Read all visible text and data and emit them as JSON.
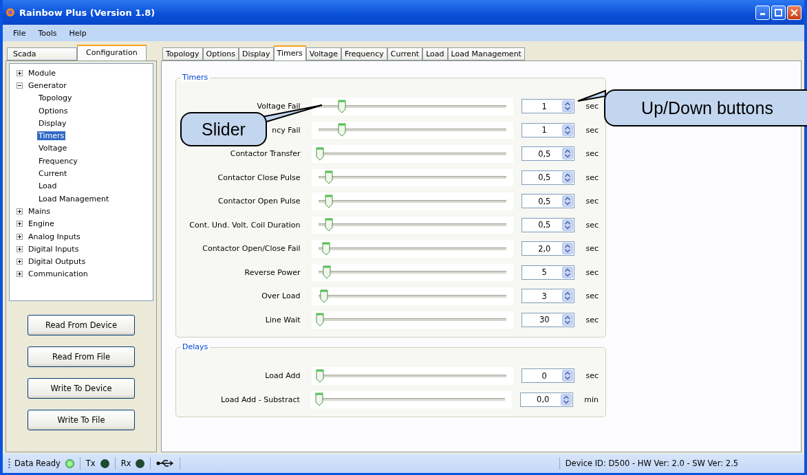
{
  "window": {
    "title": "Rainbow Plus (Version 1.8)"
  },
  "menu": [
    "File",
    "Tools",
    "Help"
  ],
  "left_tabs": [
    {
      "label": "Scada",
      "selected": false
    },
    {
      "label": "Configuration",
      "selected": true
    }
  ],
  "tree": [
    {
      "label": "Module",
      "expanded": false,
      "selected": false
    },
    {
      "label": "Generator",
      "expanded": true,
      "selected": false,
      "children": [
        {
          "label": "Topology",
          "selected": false
        },
        {
          "label": "Options",
          "selected": false
        },
        {
          "label": "Display",
          "selected": false
        },
        {
          "label": "Timers",
          "selected": true
        },
        {
          "label": "Voltage",
          "selected": false
        },
        {
          "label": "Frequency",
          "selected": false
        },
        {
          "label": "Current",
          "selected": false
        },
        {
          "label": "Load",
          "selected": false
        },
        {
          "label": "Load Management",
          "selected": false
        }
      ]
    },
    {
      "label": "Mains",
      "expanded": false,
      "selected": false
    },
    {
      "label": "Engine",
      "expanded": false,
      "selected": false
    },
    {
      "label": "Analog Inputs",
      "expanded": false,
      "selected": false
    },
    {
      "label": "Digital Inputs",
      "expanded": false,
      "selected": false
    },
    {
      "label": "Digital Outputs",
      "expanded": false,
      "selected": false
    },
    {
      "label": "Communication",
      "expanded": false,
      "selected": false
    }
  ],
  "buttons": [
    "Read From Device",
    "Read From File",
    "Write To Device",
    "Write To File"
  ],
  "tabs": [
    {
      "label": "Topology",
      "selected": false
    },
    {
      "label": "Options",
      "selected": false
    },
    {
      "label": "Display",
      "selected": false
    },
    {
      "label": "Timers",
      "selected": true
    },
    {
      "label": "Voltage",
      "selected": false
    },
    {
      "label": "Frequency",
      "selected": false
    },
    {
      "label": "Current",
      "selected": false
    },
    {
      "label": "Load",
      "selected": false
    },
    {
      "label": "Load Management",
      "selected": false
    }
  ],
  "groups": [
    {
      "title": "Timers",
      "rows": [
        {
          "label": "Voltage Fail",
          "level": 0.12,
          "value": "1",
          "unit": "sec"
        },
        {
          "label": "ncy Fail",
          "level": 0.12,
          "value": "1",
          "unit": "sec"
        },
        {
          "label": "Contactor Transfer",
          "level": 0,
          "value": "0,5",
          "unit": "sec"
        },
        {
          "label": "Contactor Close Pulse",
          "level": 0.05,
          "value": "0,5",
          "unit": "sec"
        },
        {
          "label": "Contactor Open Pulse",
          "level": 0.05,
          "value": "0,5",
          "unit": "sec"
        },
        {
          "label": "Cont. Und. Volt. Coil Duration",
          "level": 0.05,
          "value": "0,5",
          "unit": "sec"
        },
        {
          "label": "Contactor Open/Close Fail",
          "level": 0.035,
          "value": "2,0",
          "unit": "sec"
        },
        {
          "label": "Reverse Power",
          "level": 0.04,
          "value": "5",
          "unit": "sec"
        },
        {
          "label": "Over Load",
          "level": 0.025,
          "value": "3",
          "unit": "sec"
        },
        {
          "label": "Line Wait",
          "level": 0,
          "value": "30",
          "unit": "sec"
        }
      ]
    },
    {
      "title": "Delays",
      "rows": [
        {
          "label": "Load Add",
          "level": 0,
          "value": "0",
          "unit": "sec"
        },
        {
          "label": "Load Add - Substract",
          "level": 0,
          "value": "0,0",
          "unit": "min"
        }
      ]
    }
  ],
  "callouts": [
    {
      "text": "Slider"
    },
    {
      "text": "Up/Down buttons"
    }
  ],
  "status_bar": {
    "indicators": [
      {
        "label": "Data Ready",
        "on": true
      },
      {
        "label": "Tx",
        "on": false
      },
      {
        "label": "Rx",
        "on": false
      }
    ],
    "device_info": "Device ID: D500 - HW Ver: 2.0 - SW Ver: 2.5"
  }
}
